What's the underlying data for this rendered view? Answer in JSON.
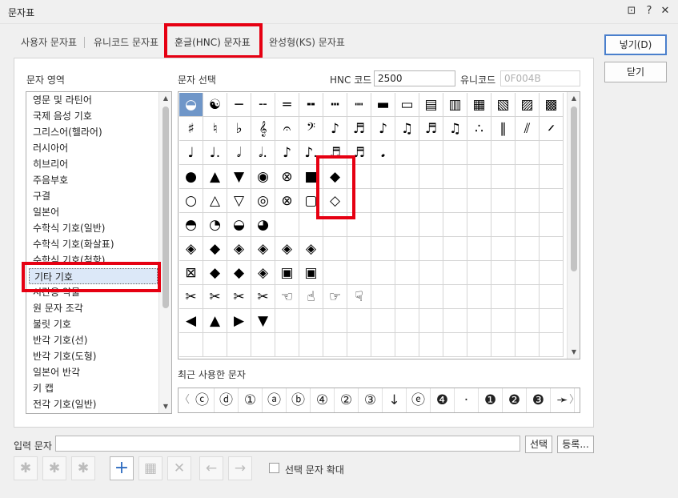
{
  "window": {
    "title": "문자표",
    "buttons": {
      "restore": "⊡",
      "help": "?",
      "close": "✕"
    }
  },
  "tabs": [
    {
      "label": "사용자 문자표"
    },
    {
      "label": "유니코드 문자표"
    },
    {
      "label": "훈글(HNC) 문자표",
      "active": true
    },
    {
      "label": "완성형(KS) 문자표"
    }
  ],
  "area": {
    "label": "문자 영역",
    "items": [
      "영문 및 라틴어",
      "국제 음성 기호",
      "그리스어(헬라어)",
      "러시아어",
      "히브리어",
      "주음부호",
      "구결",
      "일본어",
      "수학식 기호(일반)",
      "수학식 기호(화살표)",
      "수학식 기호(첨항)",
      "기타 기호",
      "시간용 약물",
      "원 문자 조각",
      "불릿 기호",
      "반각 기호(선)",
      "반각 기호(도형)",
      "일본어 반각",
      "키 캡",
      "전각 기호(일반)"
    ],
    "selected_index": 11
  },
  "selection": {
    "label": "문자 선택",
    "hnc_label": "HNC 코드",
    "hnc_value": "2500",
    "unicode_label": "유니코드",
    "unicode_value": "0F004B"
  },
  "grid": {
    "rows": [
      [
        "◒",
        "☯",
        "─",
        "╌",
        "═",
        "╍",
        "┅",
        "┉",
        "▬",
        "▭",
        "▤",
        "▥",
        "▦",
        "▧",
        "▨",
        "▩"
      ],
      [
        "♯",
        "♮",
        "♭",
        "𝄞",
        "𝄐",
        "𝄢",
        "♪",
        "♬",
        "♪",
        "♫",
        "♬",
        "♫",
        "∴",
        "∥",
        "⫽",
        "𝄍"
      ],
      [
        "♩",
        "♩.",
        "𝅗𝅥",
        "𝅗𝅥.",
        "♪",
        "♪.",
        "♬",
        "♬",
        "𝅘",
        "",
        "",
        "",
        "",
        "",
        "",
        ""
      ],
      [
        "●",
        "▲",
        "▼",
        "◉",
        "⊗",
        "■",
        "◆",
        "",
        "",
        "",
        "",
        "",
        "",
        "",
        "",
        ""
      ],
      [
        "○",
        "△",
        "▽",
        "◎",
        "⊗",
        "▢",
        "◇",
        "",
        "",
        "",
        "",
        "",
        "",
        "",
        "",
        ""
      ],
      [
        "◓",
        "◔",
        "◒",
        "◕",
        "",
        "",
        "",
        "",
        "",
        "",
        "",
        "",
        "",
        "",
        "",
        ""
      ],
      [
        "◈",
        "◆",
        "◈",
        "◈",
        "◈",
        "◈",
        "",
        "",
        "",
        "",
        "",
        "",
        "",
        "",
        "",
        ""
      ],
      [
        "⊠",
        "◆",
        "◆",
        "◈",
        "▣",
        "▣",
        "",
        "",
        "",
        "",
        "",
        "",
        "",
        "",
        "",
        ""
      ],
      [
        "✂",
        "✂",
        "✂",
        "✂",
        "☜",
        "☝",
        "☞",
        "☟",
        "",
        "",
        "",
        "",
        "",
        "",
        "",
        ""
      ],
      [
        "◀",
        "▲",
        "▶",
        "▼",
        "",
        "",
        "",
        "",
        "",
        "",
        "",
        "",
        "",
        "",
        "",
        ""
      ],
      [
        "",
        "",
        "",
        "",
        "",
        "",
        "",
        "",
        "",
        "",
        "",
        "",
        "",
        "",
        "",
        ""
      ]
    ],
    "selected": [
      0,
      0
    ]
  },
  "recent": {
    "label": "최근 사용한 문자",
    "items": [
      "ⓒ",
      "ⓓ",
      "①",
      "ⓐ",
      "ⓑ",
      "④",
      "②",
      "③",
      "↓",
      "ⓔ",
      "❹",
      "·",
      "❶",
      "❷",
      "❸",
      "➛"
    ],
    "prev": "〈",
    "next": "〉"
  },
  "input": {
    "label": "입력 문자",
    "value": "",
    "select_button": "선택",
    "register_button": "등록..."
  },
  "buttons": {
    "insert": "넣기(D)",
    "close": "닫기"
  },
  "toolbar": {
    "icons": [
      "✱",
      "✱",
      "✱",
      "+",
      "▦",
      "✕",
      "←",
      "→"
    ],
    "enlarge_label": "선택 문자 확대"
  }
}
